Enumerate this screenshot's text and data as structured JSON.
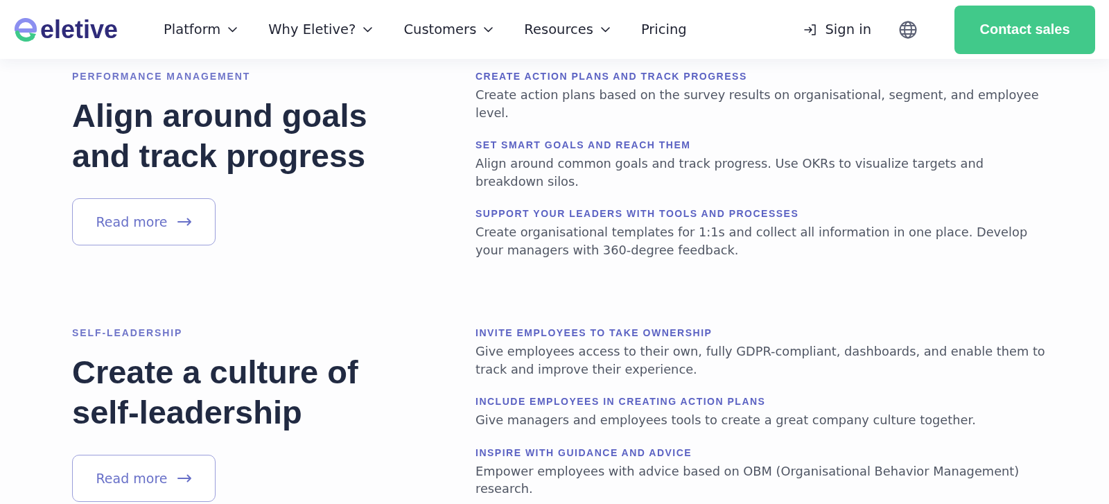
{
  "header": {
    "logo_text": "eletive",
    "nav": [
      {
        "label": "Platform",
        "has_menu": true
      },
      {
        "label": "Why Eletive?",
        "has_menu": true
      },
      {
        "label": "Customers",
        "has_menu": true
      },
      {
        "label": "Resources",
        "has_menu": true
      },
      {
        "label": "Pricing",
        "has_menu": false
      }
    ],
    "sign_in": "Sign in",
    "contact_button": "Contact sales"
  },
  "sections": [
    {
      "eyebrow": "PERFORMANCE MANAGEMENT",
      "title": "Align around goals and track progress",
      "button": "Read more",
      "features": [
        {
          "title": "CREATE ACTION PLANS AND TRACK PROGRESS",
          "text": "Create action plans based on the survey results on organisational, segment, and employee level."
        },
        {
          "title": "SET SMART GOALS AND REACH THEM",
          "text": "Align around common goals and track progress. Use OKRs to visualize targets and breakdown silos."
        },
        {
          "title": "SUPPORT YOUR LEADERS WITH TOOLS AND PROCESSES",
          "text": "Create organisational templates for 1:1s and collect all information in one place. Develop your managers with 360-degree feedback."
        }
      ]
    },
    {
      "eyebrow": "SELF-LEADERSHIP",
      "title": "Create a culture of self-leadership",
      "button": "Read more",
      "features": [
        {
          "title": "INVITE EMPLOYEES TO TAKE OWNERSHIP",
          "text": "Give employees access to their own, fully GDPR-compliant, dashboards, and enable them to track and improve their experience."
        },
        {
          "title": "INCLUDE EMPLOYEES IN CREATING ACTION PLANS",
          "text": "Give managers and employees tools to create a great company culture together."
        },
        {
          "title": "INSPIRE WITH GUIDANCE AND ADVICE",
          "text": "Empower employees with advice based on OBM (Organisational Behavior Management) research."
        }
      ]
    }
  ]
}
